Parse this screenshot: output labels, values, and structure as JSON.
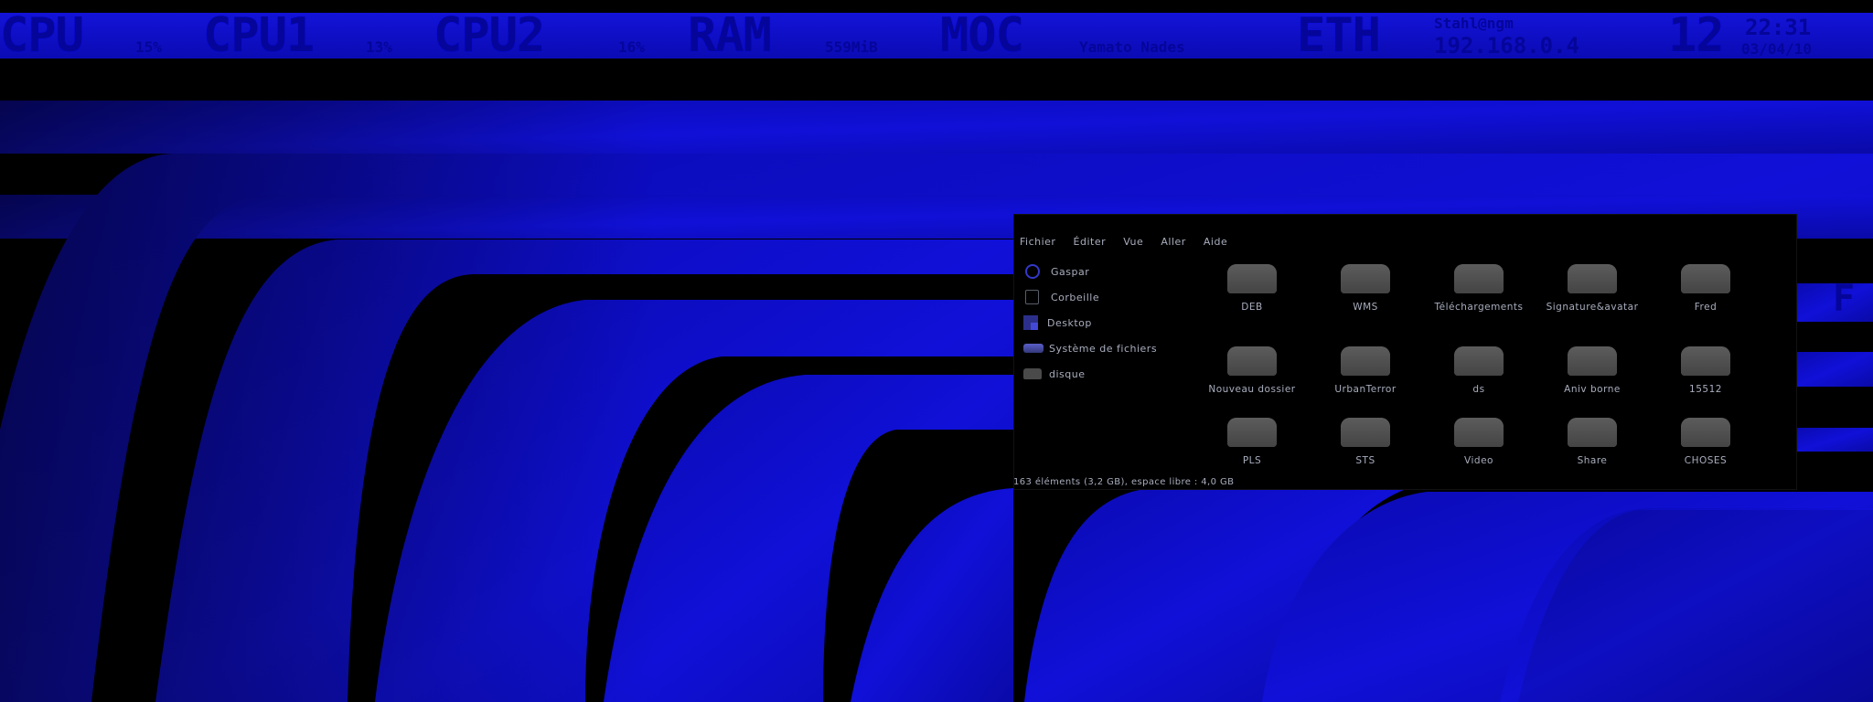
{
  "topbar": {
    "cpu_label": "CPU",
    "cpu_value": "15%",
    "cpu1_label": "CPU1",
    "cpu1_value": "13%",
    "cpu2_label": "CPU2",
    "cpu2_value": "16%",
    "ram_label": "RAM",
    "ram_value": "559MiB",
    "moc_label": "MOC",
    "moc_value": "Yamato Nades",
    "eth_label": "ETH",
    "eth_line1": "Stahl@ngm",
    "ip": "192.168.0.4",
    "day": "12",
    "time": "22:31",
    "date": "03/04/10"
  },
  "side_glyph": "F",
  "file_manager": {
    "menu": [
      "Fichier",
      "Éditer",
      "Vue",
      "Aller",
      "Aide"
    ],
    "places": [
      {
        "label": "Gaspar",
        "icon": "home-icon"
      },
      {
        "label": "Corbeille",
        "icon": "trash-icon"
      },
      {
        "label": "Desktop",
        "icon": "desktop-icon"
      },
      {
        "label": "Système de fichiers",
        "icon": "filesystem-icon"
      },
      {
        "label": "disque",
        "icon": "disk-icon"
      }
    ],
    "files": [
      {
        "name": "DEB"
      },
      {
        "name": "WMS"
      },
      {
        "name": "Téléchargements"
      },
      {
        "name": "Signature&avatar"
      },
      {
        "name": "Fred"
      },
      {
        "name": "Nouveau dossier"
      },
      {
        "name": "UrbanTerror"
      },
      {
        "name": "ds"
      },
      {
        "name": "Aniv borne"
      },
      {
        "name": "15512"
      },
      {
        "name": "PLS"
      },
      {
        "name": "STS"
      },
      {
        "name": "Video"
      },
      {
        "name": "Share"
      },
      {
        "name": "CHOSES"
      }
    ],
    "status": "163 éléments (3,2 GB), espace libre : 4,0 GB"
  },
  "colors": {
    "accent": "#1313d8",
    "bar_text": "#05059a",
    "wallpaper_blue": "#0d0de8"
  }
}
